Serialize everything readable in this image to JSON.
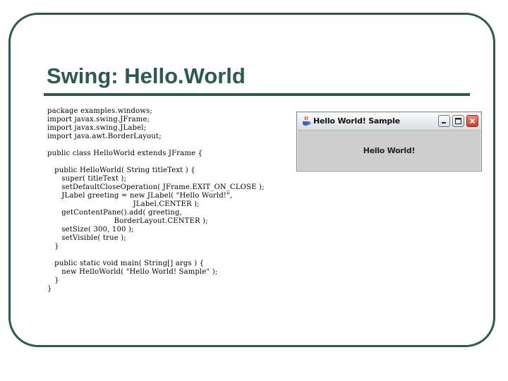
{
  "slide": {
    "title": "Swing: Hello.World",
    "code_lines": [
      "package examples.windows;",
      "import javax.swing.JFrame;",
      "import javax.swing.JLabel;",
      "import java.awt.BorderLayout;",
      "",
      "public class HelloWorld extends JFrame {",
      "",
      "   public HelloWorld( String titleText ) {",
      "      super( titleText );",
      "      setDefaultCloseOperation( JFrame.EXIT_ON_CLOSE );",
      "      JLabel greeting = new JLabel( \"Hello World!\",",
      "                                    JLabel.CENTER );",
      "      getContentPane().add( greeting,",
      "                            BorderLayout.CENTER );",
      "      setSize( 300, 100 );",
      "      setVisible( true );",
      "   }",
      "",
      "   public static void main( String[] args ) {",
      "      new HelloWorld( \"Hello World! Sample\" );",
      "   }",
      "}"
    ]
  },
  "window": {
    "title": "Hello World! Sample",
    "label": "Hello World!",
    "icons": {
      "app": "java-cup-icon",
      "minimize": "minimize-icon",
      "maximize": "maximize-icon",
      "close": "close-icon"
    }
  },
  "colors": {
    "accent": "#2c5a52",
    "window_bg": "#cecece",
    "close_button": "#c9402c"
  }
}
